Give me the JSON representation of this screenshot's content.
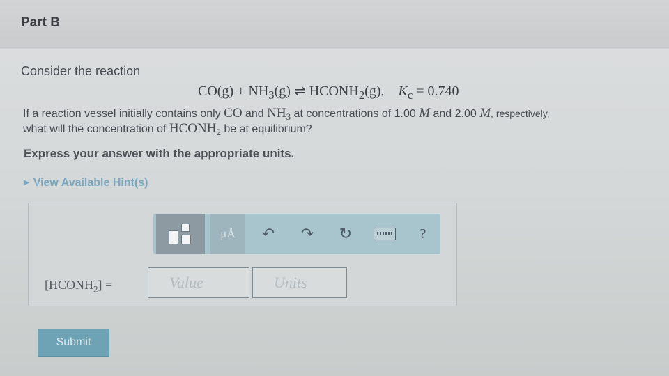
{
  "part": {
    "title": "Part B"
  },
  "intro": "Consider the reaction",
  "equation": {
    "reactant1": "CO(g)",
    "plus": " + ",
    "reactant2": "NH",
    "reactant2_sub": "3",
    "reactant2_state": "(g)",
    "arrow": "⇌",
    "product": "HCONH",
    "product_sub": "2",
    "product_state": "(g),",
    "k_symbol": "K",
    "k_sub": "c",
    "k_eq": " = 0.740"
  },
  "question": {
    "t1": "If a reaction vessel initially contains only ",
    "co": "CO",
    "t2": " and ",
    "nh": "NH",
    "nh_sub": "3",
    "t3": " at concentrations of 1.00 ",
    "m1": "M",
    "t4": " and 2.00 ",
    "m2": "M",
    "t5": ", respectively,",
    "t6": "what will the concentration of ",
    "hconh": "HCONH",
    "hconh_sub": "2",
    "t7": " be at equilibrium?"
  },
  "instruction": "Express your answer with the appropriate units.",
  "hints": {
    "label": "View Available Hint(s)"
  },
  "toolbar": {
    "units_label": "μÅ",
    "undo_icon": "↶",
    "redo_icon": "↷",
    "reset_icon": "↻",
    "help_label": "?"
  },
  "answer": {
    "label_prefix": "[HCONH",
    "label_sub": "2",
    "label_suffix": "] =",
    "value_placeholder": "Value",
    "units_placeholder": "Units"
  },
  "submit": {
    "label": "Submit"
  },
  "colors": {
    "accent": "#6ea3b6",
    "toolbar": "#a8c4cc",
    "hint": "#7aa7be"
  }
}
